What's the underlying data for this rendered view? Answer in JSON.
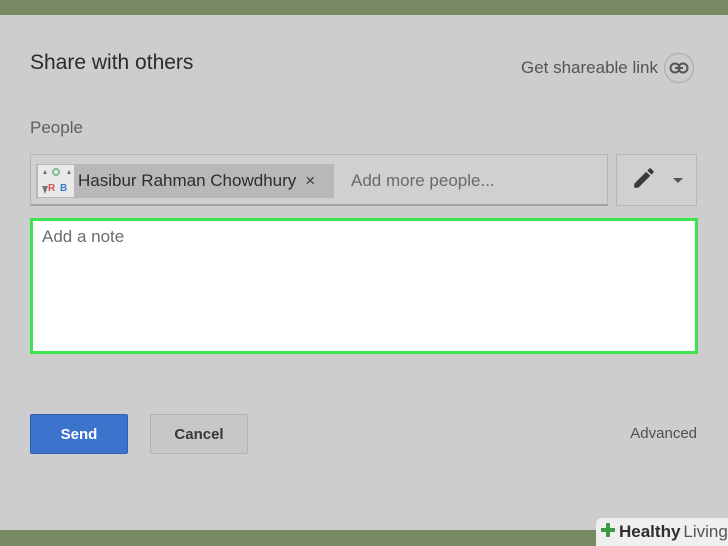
{
  "dialog": {
    "title": "Share with others",
    "share_link_label": "Get shareable link",
    "share_link_icon": "link-icon"
  },
  "people": {
    "label": "People",
    "chip": {
      "name": "Hasibur Rahman Chowdhury",
      "close_symbol": "×",
      "avatar_letters": [
        "R",
        "B"
      ]
    },
    "input_placeholder": "Add more people...",
    "permission_icon": "pencil-icon"
  },
  "note": {
    "placeholder": "Add a note"
  },
  "actions": {
    "send_label": "Send",
    "cancel_label": "Cancel",
    "advanced_label": "Advanced"
  },
  "watermark": {
    "brand_bold": "Healthy",
    "brand_light": "Living"
  },
  "colors": {
    "frame": "#778a63",
    "dialog_bg": "#cdcdcd",
    "send_button": "#3c73cc",
    "note_focus_border": "#3ee34f",
    "watermark_plus": "#3e9a46"
  }
}
